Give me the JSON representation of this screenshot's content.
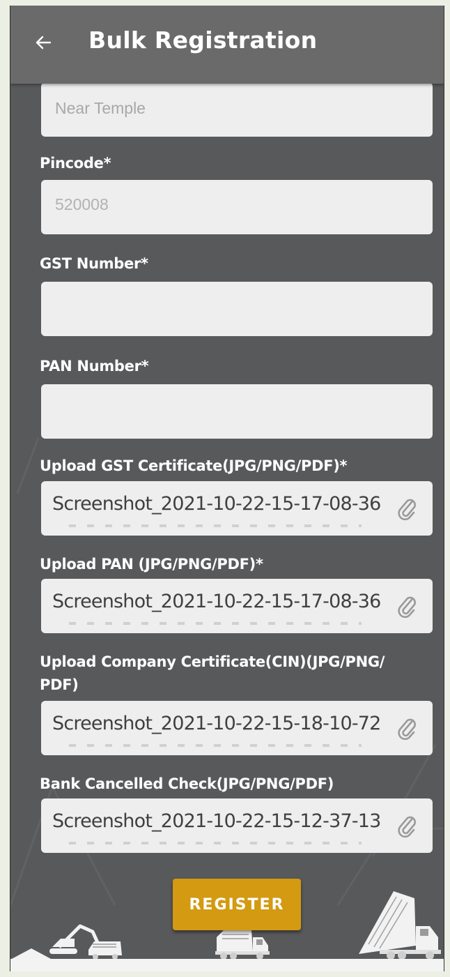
{
  "header": {
    "title": "Bulk Registration"
  },
  "fields": {
    "address_line": {
      "placeholder": "Near Temple"
    },
    "pincode": {
      "label": "Pincode*",
      "value": "520008"
    },
    "gst": {
      "label": "GST Number*",
      "value": ""
    },
    "pan": {
      "label": "PAN Number*",
      "value": ""
    }
  },
  "uploads": {
    "gst_certificate": {
      "label": "Upload GST Certificate(JPG/PNG/PDF)*",
      "file": "Screenshot_2021-10-22-15-17-08-36"
    },
    "pan": {
      "label": "Upload PAN (JPG/PNG/PDF)*",
      "file": "Screenshot_2021-10-22-15-17-08-36"
    },
    "company_certificate": {
      "label_line1": "Upload Company Certificate(CIN)(JPG/PNG/",
      "label_line2": "PDF)",
      "file": "Screenshot_2021-10-22-15-18-10-72"
    },
    "cancelled_check": {
      "label": "Bank Cancelled Check(JPG/PNG/PDF)",
      "file": "Screenshot_2021-10-22-15-12-37-13"
    }
  },
  "actions": {
    "register_label": "REGISTER"
  },
  "icons": [
    "back-arrow-icon",
    "paperclip-icon",
    "excavator-icon",
    "dump-truck-icon",
    "tipper-truck-icon"
  ],
  "colors": {
    "background": "#58595b",
    "appbar": "#6a6a6a",
    "field": "#eeeeee",
    "accent": "#d39a12"
  }
}
